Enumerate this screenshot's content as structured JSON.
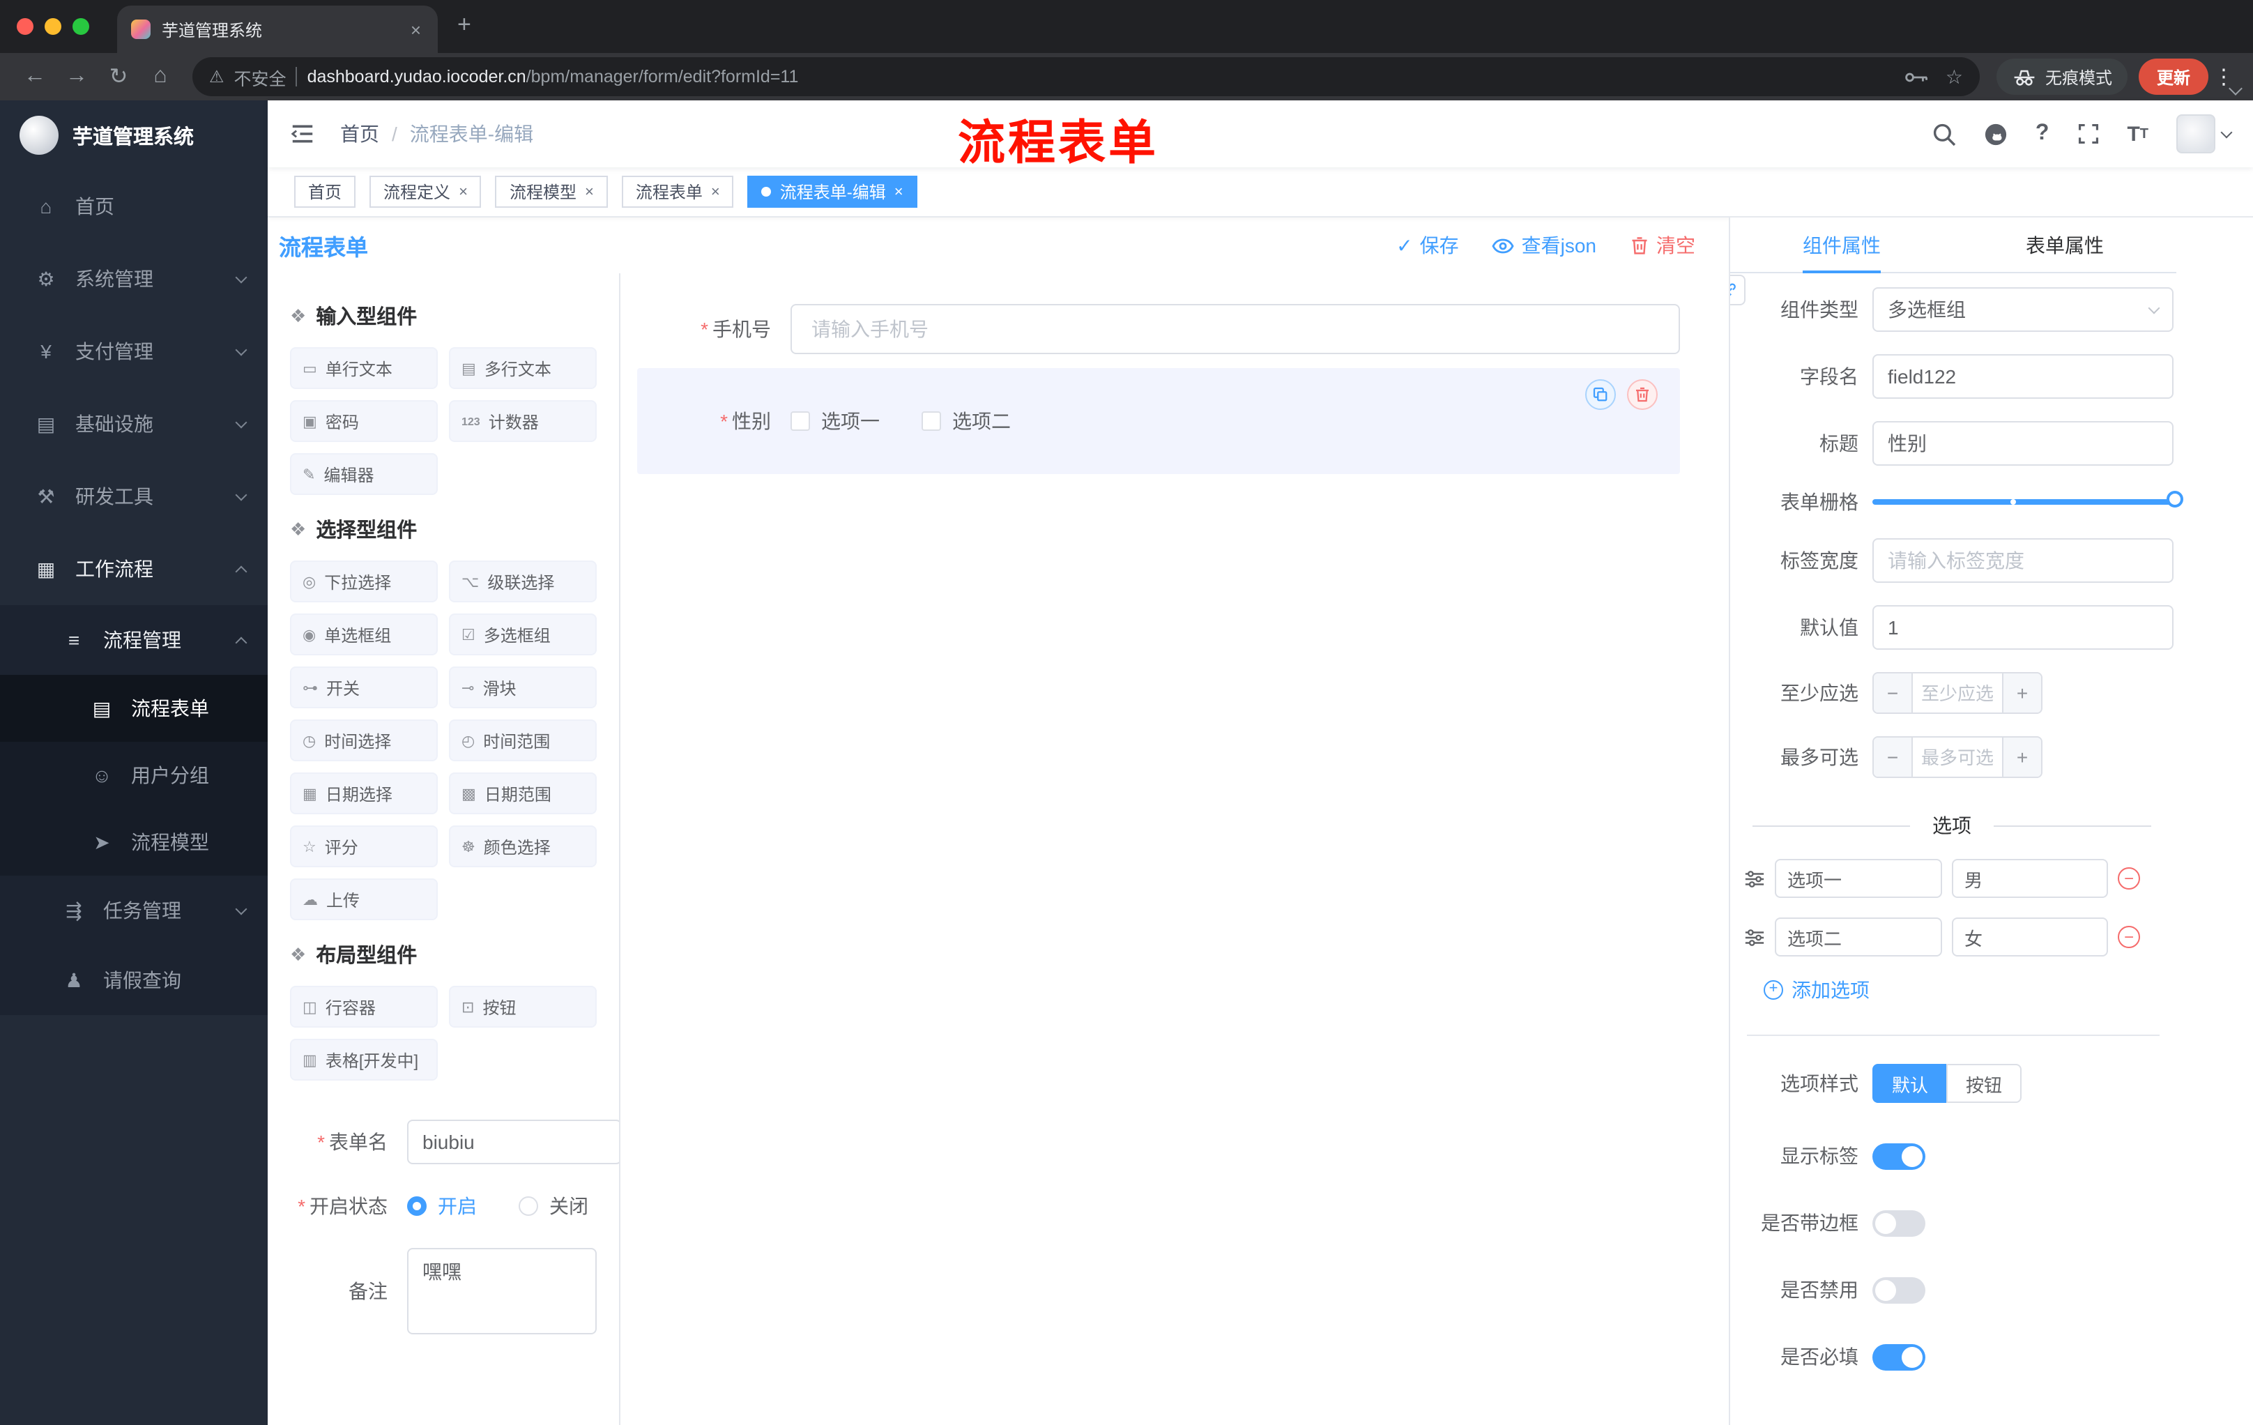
{
  "theme": {
    "primary": "#409EFF",
    "danger": "#F56C6C",
    "sidebar_bg": "#232B38",
    "annotation_red": "#FF1200"
  },
  "annotation": {
    "text": "流程表单"
  },
  "browser": {
    "tab": {
      "title": "芋道管理系统",
      "close_label": "×",
      "new_tab_label": "+"
    },
    "toolbar": {
      "back": "←",
      "forward": "→",
      "reload": "↻",
      "home": "⌂",
      "warning": "⚠",
      "security_text": "不安全",
      "url_domain": "dashboard.yudao.iocoder.cn",
      "url_path": "/bpm/manager/form/edit?formId=11",
      "star": "☆",
      "incognito_label": "无痕模式",
      "update_label": "更新",
      "menu": "⋮"
    }
  },
  "sidebar": {
    "title": "芋道管理系统",
    "items": [
      {
        "label": "首页",
        "icon": "⌂"
      },
      {
        "label": "系统管理",
        "icon": "⚙"
      },
      {
        "label": "支付管理",
        "icon": "¥"
      },
      {
        "label": "基础设施",
        "icon": "▤"
      },
      {
        "label": "研发工具",
        "icon": "⚒"
      },
      {
        "label": "工作流程",
        "icon": "▦"
      },
      {
        "label": "流程管理",
        "icon": "≡"
      },
      {
        "label": "流程表单",
        "icon": "▤"
      },
      {
        "label": "用户分组",
        "icon": "☺"
      },
      {
        "label": "流程模型",
        "icon": "➤"
      },
      {
        "label": "任务管理",
        "icon": "⇶"
      },
      {
        "label": "请假查询",
        "icon": "♟"
      }
    ]
  },
  "header": {
    "breadcrumb": {
      "root": "首页",
      "separator": "/",
      "current": "流程表单-编辑"
    }
  },
  "tags": [
    {
      "label": "首页"
    },
    {
      "label": "流程定义"
    },
    {
      "label": "流程模型"
    },
    {
      "label": "流程表单"
    },
    {
      "label": "流程表单-编辑"
    }
  ],
  "designer": {
    "title": "流程表单",
    "actions": {
      "save": "保存",
      "save_check": "✓",
      "view_json": "查看json",
      "clear": "清空"
    },
    "palette": {
      "groups": [
        {
          "title": "输入型组件",
          "items": [
            {
              "label": "单行文本",
              "icon": "▭"
            },
            {
              "label": "多行文本",
              "icon": "▤"
            },
            {
              "label": "密码",
              "icon": "▣"
            },
            {
              "label": "计数器",
              "icon": "123"
            },
            {
              "label": "编辑器",
              "icon": "✎"
            }
          ]
        },
        {
          "title": "选择型组件",
          "items": [
            {
              "label": "下拉选择",
              "icon": "◎"
            },
            {
              "label": "级联选择",
              "icon": "⌥"
            },
            {
              "label": "单选框组",
              "icon": "◉"
            },
            {
              "label": "多选框组",
              "icon": "☑"
            },
            {
              "label": "开关",
              "icon": "⊶"
            },
            {
              "label": "滑块",
              "icon": "⊸"
            },
            {
              "label": "时间选择",
              "icon": "◷"
            },
            {
              "label": "时间范围",
              "icon": "◴"
            },
            {
              "label": "日期选择",
              "icon": "▦"
            },
            {
              "label": "日期范围",
              "icon": "▩"
            },
            {
              "label": "评分",
              "icon": "☆"
            },
            {
              "label": "颜色选择",
              "icon": "☸"
            },
            {
              "label": "上传",
              "icon": "☁"
            }
          ]
        },
        {
          "title": "布局型组件",
          "items": [
            {
              "label": "行容器",
              "icon": "◫"
            },
            {
              "label": "按钮",
              "icon": "⊡"
            },
            {
              "label": "表格[开发中]",
              "icon": "▥"
            }
          ]
        }
      ]
    },
    "form_meta": {
      "name_label": "表单名",
      "name_value": "biubiu",
      "status_label": "开启状态",
      "status_on": "开启",
      "status_off": "关闭",
      "remark_label": "备注",
      "remark_value": "嘿嘿"
    },
    "canvas": {
      "phone_label": "手机号",
      "phone_placeholder": "请输入手机号",
      "gender_label": "性别",
      "gender_option1": "选项一",
      "gender_option2": "选项二"
    }
  },
  "properties": {
    "tab_component": "组件属性",
    "tab_form": "表单属性",
    "component_type": {
      "label": "组件类型",
      "value": "多选框组"
    },
    "field_name": {
      "label": "字段名",
      "value": "field122"
    },
    "title_field": {
      "label": "标题",
      "value": "性别"
    },
    "grid": {
      "label": "表单栅格"
    },
    "label_width": {
      "label": "标签宽度",
      "placeholder": "请输入标签宽度"
    },
    "default_value": {
      "label": "默认值",
      "value": "1"
    },
    "min_select": {
      "label": "至少应选",
      "placeholder": "至少应选"
    },
    "max_select": {
      "label": "最多可选",
      "placeholder": "最多可选"
    },
    "options": {
      "divider": "选项",
      "rows": [
        {
          "label": "选项一",
          "value": "男"
        },
        {
          "label": "选项二",
          "value": "女"
        }
      ],
      "add_label": "添加选项"
    },
    "option_style": {
      "label": "选项样式",
      "default": "默认",
      "button": "按钮"
    },
    "switches": [
      {
        "label": "显示标签",
        "on": true
      },
      {
        "label": "是否带边框",
        "on": false
      },
      {
        "label": "是否禁用",
        "on": false
      },
      {
        "label": "是否必填",
        "on": true
      }
    ]
  }
}
